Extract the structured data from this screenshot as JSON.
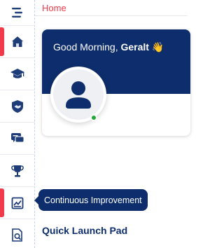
{
  "breadcrumb": {
    "home": "Home"
  },
  "sidebar": {
    "items": [
      {
        "name": "home",
        "icon": "home-icon",
        "active": true
      },
      {
        "name": "learning",
        "icon": "graduation-cap-icon",
        "active": false
      },
      {
        "name": "recognition",
        "icon": "shield-handshake-icon",
        "active": false
      },
      {
        "name": "feedback",
        "icon": "chat-icon",
        "active": false
      },
      {
        "name": "awards",
        "icon": "trophy-icon",
        "active": false
      },
      {
        "name": "continuous-improvement",
        "icon": "chart-icon",
        "active": true
      },
      {
        "name": "reports",
        "icon": "document-search-icon",
        "active": false
      }
    ]
  },
  "welcome": {
    "greeting_prefix": "Good Morning, ",
    "user_name": "Geralt",
    "wave_emoji": "👋",
    "status": "online"
  },
  "tooltip": {
    "label": "Continuous Improvement"
  },
  "sections": {
    "quick_launch": "Quick Launch Pad"
  },
  "colors": {
    "navy": "#0d2d6c",
    "accent_red": "#ef3b4a",
    "online_green": "#22a93a"
  }
}
